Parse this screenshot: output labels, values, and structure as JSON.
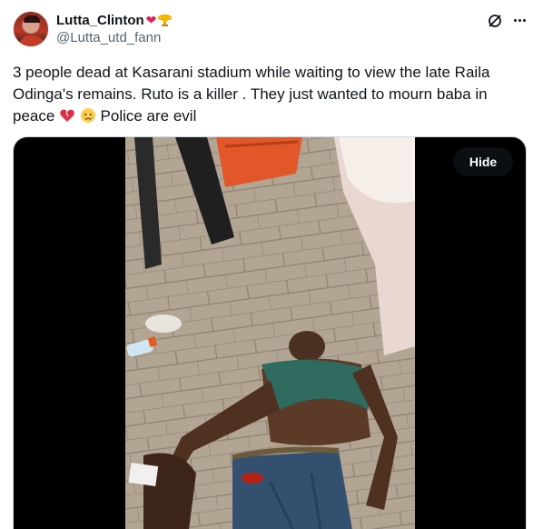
{
  "author": {
    "display_name": "Lutta_Clinton",
    "handle": "@Lutta_utd_fann",
    "name_emojis": [
      "red-heart-icon",
      "trophy-icon"
    ]
  },
  "header_actions": {
    "grok_icon": "grok-icon",
    "more_icon": "more-options-icon"
  },
  "tweet": {
    "text_line": "3 people dead at Kasarani stadium while waiting to view the late Raila Odinga's remains. Ruto is a killer . They just wanted to mourn baba in peace",
    "text_tail": "Police are evil",
    "emojis": [
      "broken-heart-icon",
      "sad-relieved-face-icon"
    ]
  },
  "media": {
    "hide_label": "Hide",
    "image_content": "photo-of-injured-man-lying-on-pavement"
  },
  "colors": {
    "text_primary": "#0f1419",
    "text_secondary": "#536471",
    "border": "#cfd9de",
    "heart": "#e0245e",
    "hide_button_bg": "#0f1419"
  }
}
